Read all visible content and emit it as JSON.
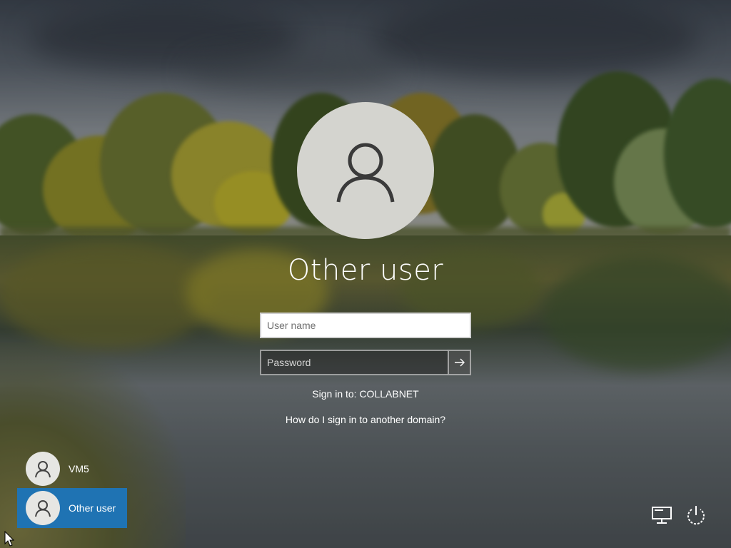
{
  "login": {
    "account_name": "Other user",
    "username_placeholder": "User name",
    "password_placeholder": "Password",
    "sign_in_to": "Sign in to: COLLABNET",
    "domain_help_link": "How do I sign in to another domain?"
  },
  "users": [
    {
      "label": "VM5",
      "selected": false
    },
    {
      "label": "Other user",
      "selected": true
    }
  ],
  "icons": {
    "avatar": "user-avatar-icon",
    "submit": "arrow-right-icon",
    "network": "network-icon",
    "power": "power-icon"
  },
  "colors": {
    "selected_tile": "#1f73b3",
    "avatar_bg": "#d4d4cf"
  }
}
